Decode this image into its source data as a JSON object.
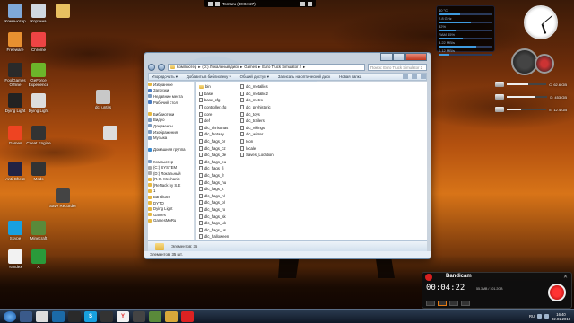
{
  "topbar": {
    "label": "Tomaru (30:04:27)"
  },
  "desktop_icons": [
    {
      "label": "Компьютер",
      "color": "#7fa8d8"
    },
    {
      "label": "Корзина",
      "color": "#d0d8e0"
    },
    {
      "label": "",
      "color": "#e8c060"
    },
    {
      "label": "Freeware",
      "color": "#e89030"
    },
    {
      "label": "Chrome",
      "color": "#e44"
    },
    {
      "label": "FoolGames Offline",
      "color": "#2a2a2a"
    },
    {
      "label": "GeForce Experience",
      "color": "#6cb52a"
    },
    {
      "label": "dc_untits",
      "color": "#c8c8c8"
    },
    {
      "label": "Dying Light",
      "color": "#222"
    },
    {
      "label": "Dying Light",
      "color": "#ddd"
    },
    {
      "label": "",
      "color": "#ddd"
    },
    {
      "label": "Games",
      "color": "#e42"
    },
    {
      "label": "Cheat Engine",
      "color": "#333"
    },
    {
      "label": "Anti-Cheat",
      "color": "#224"
    },
    {
      "label": "Mods",
      "color": "#333"
    },
    {
      "label": "Save Recorder",
      "color": "#444"
    },
    {
      "label": "Skype",
      "color": "#18a0e0"
    },
    {
      "label": "Minecraft",
      "color": "#5a8a3a"
    },
    {
      "label": "Yandex",
      "color": "#f2f2f2"
    },
    {
      "label": "A",
      "color": "#2a9a3a"
    }
  ],
  "window": {
    "breadcrumb": [
      "Компьютер",
      "(D:) Локальный диск",
      "Games",
      "Euro Truck Simulator 2"
    ],
    "search_placeholder": "Поиск: Euro Truck Simulator 2",
    "commands": [
      "Упорядочить ▾",
      "Добавить в библиотеку ▾",
      "Общий доступ ▾",
      "Записать на оптический диск",
      "Новая папка"
    ],
    "nav": [
      {
        "label": "Избранное",
        "color": "#e6b840"
      },
      {
        "label": "Загрузки",
        "color": "#4a7bc0"
      },
      {
        "label": "Недавние места",
        "color": "#7a9ac0"
      },
      {
        "label": "Рабочий стол",
        "color": "#4a7bc0"
      },
      {
        "label": "",
        "color": "transparent"
      },
      {
        "label": "Библиотеки",
        "color": "#e6b840"
      },
      {
        "label": "Видео",
        "color": "#7a9ac0"
      },
      {
        "label": "Документы",
        "color": "#7a9ac0"
      },
      {
        "label": "Изображения",
        "color": "#7a9ac0"
      },
      {
        "label": "Музыка",
        "color": "#7a9ac0"
      },
      {
        "label": "",
        "color": "transparent"
      },
      {
        "label": "Домашняя группа",
        "color": "#3a8ad0"
      },
      {
        "label": "",
        "color": "transparent"
      },
      {
        "label": "Компьютер",
        "color": "#7a9ac0"
      },
      {
        "label": "(C:) SYSTEM",
        "color": "#aaa"
      },
      {
        "label": "(D:) Локальный",
        "color": "#aaa"
      },
      {
        "label": "[R.G. Mechanic",
        "color": "#e6b840"
      },
      {
        "label": "[ReПack by S.E",
        "color": "#e6b840"
      },
      {
        "label": "1",
        "color": "#e6b840"
      },
      {
        "label": "Bandicam",
        "color": "#e6b840"
      },
      {
        "label": "DYTO",
        "color": "#e6b840"
      },
      {
        "label": "Dying Light",
        "color": "#e6b840"
      },
      {
        "label": "Games",
        "color": "#e6b840"
      },
      {
        "label": "GamesMoRu",
        "color": "#e6b840"
      }
    ],
    "col1": [
      {
        "name": "bin",
        "type": "folder"
      },
      {
        "name": "base",
        "type": "file"
      },
      {
        "name": "base_cfg",
        "type": "file"
      },
      {
        "name": "controller.cfg",
        "type": "file"
      },
      {
        "name": "core",
        "type": "file"
      },
      {
        "name": "def",
        "type": "file"
      },
      {
        "name": "dlc_christmas",
        "type": "file"
      },
      {
        "name": "dlc_fantasy",
        "type": "file"
      },
      {
        "name": "dlc_flags_br",
        "type": "file"
      },
      {
        "name": "dlc_flags_cz",
        "type": "file"
      },
      {
        "name": "dlc_flags_de",
        "type": "file"
      },
      {
        "name": "dlc_flags_eu",
        "type": "file"
      },
      {
        "name": "dlc_flags_fi",
        "type": "file"
      },
      {
        "name": "dlc_flags_fr",
        "type": "file"
      },
      {
        "name": "dlc_flags_hu",
        "type": "file"
      },
      {
        "name": "dlc_flags_it",
        "type": "file"
      },
      {
        "name": "dlc_flags_nl",
        "type": "file"
      },
      {
        "name": "dlc_flags_pl",
        "type": "file"
      },
      {
        "name": "dlc_flags_ro",
        "type": "file"
      },
      {
        "name": "dlc_flags_sk",
        "type": "file"
      },
      {
        "name": "dlc_flags_uk",
        "type": "file"
      },
      {
        "name": "dlc_flags_us",
        "type": "file"
      },
      {
        "name": "dlc_halloween",
        "type": "file"
      }
    ],
    "col2": [
      {
        "name": "dlc_metallics",
        "type": "file"
      },
      {
        "name": "dlc_metallic2",
        "type": "file"
      },
      {
        "name": "dlc_metro",
        "type": "file"
      },
      {
        "name": "dlc_prehistoric",
        "type": "file"
      },
      {
        "name": "dlc_toys",
        "type": "file"
      },
      {
        "name": "dlc_trailers",
        "type": "file"
      },
      {
        "name": "dlc_vikings",
        "type": "file"
      },
      {
        "name": "dlc_winter",
        "type": "file"
      },
      {
        "name": "Icon",
        "type": "file"
      },
      {
        "name": "locale",
        "type": "file"
      },
      {
        "name": "Saves_Location",
        "type": "file"
      }
    ],
    "details": "Элементов: 35",
    "status": "Элементов: 35 шт."
  },
  "gadget": {
    "lines": [
      "40 °C",
      "2.8 GHz",
      "32%",
      "RAM 45%",
      "3.22 MB/s",
      "0.12 MB/s"
    ],
    "fills": [
      0.4,
      0.6,
      0.32,
      0.45,
      0.7,
      0.2
    ]
  },
  "drives": [
    {
      "label": "C: 62.6 GB",
      "fill": 0.55
    },
    {
      "label": "D: 453 GB",
      "fill": 0.7
    },
    {
      "label": "E: 12.4 GB",
      "fill": 0.35
    }
  ],
  "bandicam": {
    "title": "Bandicam",
    "time": "00:04:22",
    "size": "55.3MB / 101.2GB"
  },
  "tray": {
    "lang": "RU",
    "time": "16:40",
    "date": "02.01.2016"
  }
}
